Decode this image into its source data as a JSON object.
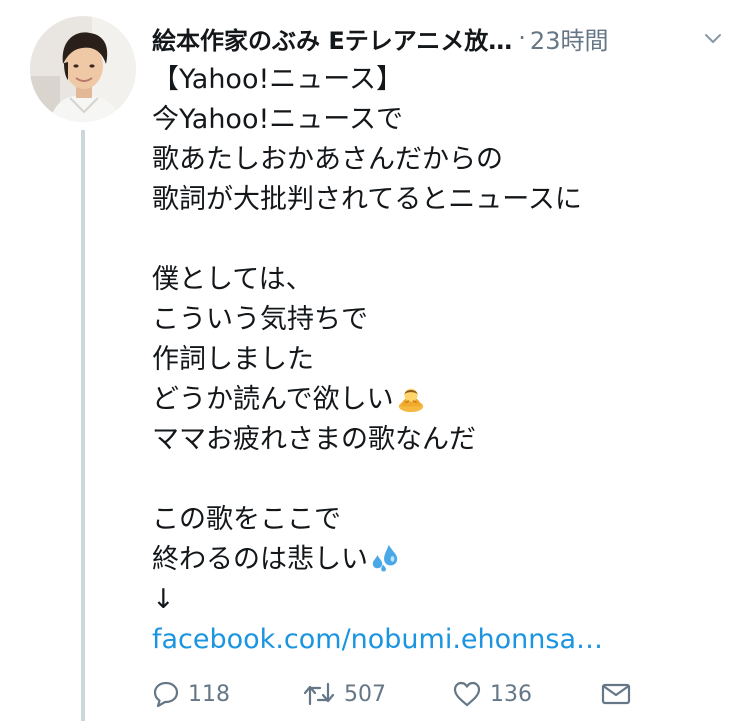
{
  "tweet": {
    "author_name": "絵本作家のぶみ Eテレアニメ放…",
    "separator": "·",
    "timestamp": "23時間",
    "lines": [
      "【Yahoo!ニュース】",
      "今Yahoo!ニュースで",
      "歌あたしおかあさんだからの",
      "歌詞が大批判されてるとニュースに",
      "",
      "僕としては、",
      "こういう気持ちで",
      "作詞しました",
      "どうか読んで欲しい",
      "ママお疲れさまの歌なんだ",
      "",
      "この歌をここで",
      "終わるのは悲しい",
      "↓"
    ],
    "link_text": "facebook.com/nobumi.ehonnsa…",
    "emojis": {
      "bowing": "person-bowing-icon",
      "sweat": "sweat-droplets-icon"
    }
  },
  "actions": {
    "reply_count": "118",
    "retweet_count": "507",
    "like_count": "136"
  },
  "colors": {
    "text": "#14171a",
    "secondary": "#657786",
    "link": "#1b95e0",
    "thread_line": "#ccd6dd"
  }
}
